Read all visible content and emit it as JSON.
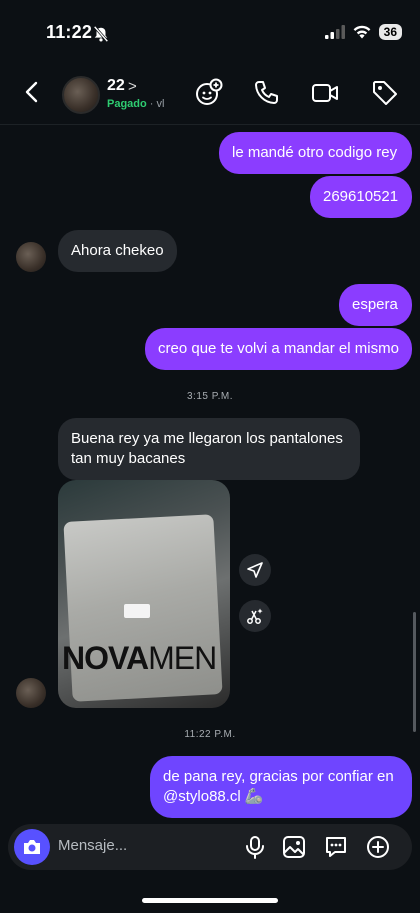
{
  "status_bar": {
    "time": "11:22",
    "battery": "36"
  },
  "header": {
    "contact_name": "22",
    "chevron": ">",
    "status_label": "Pagado",
    "status_sep": "·",
    "status_extra": "vl"
  },
  "messages": [
    {
      "direction": "out",
      "text": "le mandé otro codigo rey"
    },
    {
      "direction": "out",
      "text": "269610521"
    },
    {
      "direction": "in",
      "text": "Ahora chekeo"
    },
    {
      "direction": "out",
      "text": "espera"
    },
    {
      "direction": "out",
      "text": "creo que te volvi a mandar el mismo"
    },
    {
      "direction": "timestamp",
      "text": "3:15 P.M."
    },
    {
      "direction": "in",
      "text": "Buena rey ya me llegaron los pantalones tan muy bacanes"
    },
    {
      "direction": "in_photo",
      "brand_bold": "NOVA",
      "brand_light": "MEN"
    },
    {
      "direction": "timestamp",
      "text": "11:22 P.M."
    },
    {
      "direction": "out",
      "text": "de pana rey, gracias por confiar en @stylo88.cl 🦾"
    }
  ],
  "composer": {
    "placeholder": "Mensaje..."
  },
  "icons": {
    "header": [
      "back-chevron-icon",
      "add-people-icon",
      "phone-icon",
      "video-camera-icon",
      "tag-icon"
    ],
    "composer": [
      "camera-icon",
      "microphone-icon",
      "gallery-icon",
      "sticker-chat-icon",
      "plus-icon"
    ],
    "photo_actions": [
      "share-icon",
      "ai-sparkle-icon"
    ]
  },
  "colors": {
    "outgoing": "#8b3dff",
    "outgoing_latest": "#6f45ff",
    "incoming": "#262a2f",
    "accent_green": "#2ecc71",
    "camera_button": "#5851ff"
  }
}
